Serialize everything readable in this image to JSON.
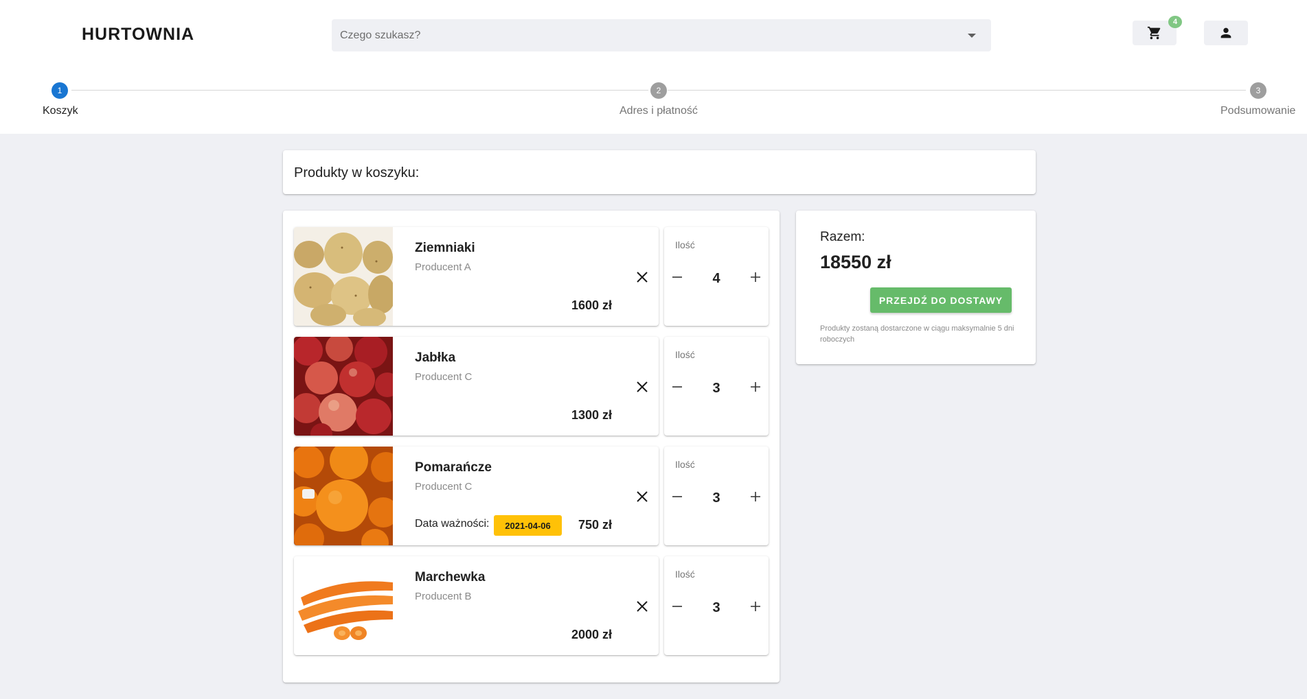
{
  "header": {
    "logo": "HURTOWNIA",
    "search_placeholder": "Czego szukasz?",
    "cart_count": "4"
  },
  "stepper": {
    "steps": [
      {
        "number": "1",
        "label": "Koszyk"
      },
      {
        "number": "2",
        "label": "Adres i płatność"
      },
      {
        "number": "3",
        "label": "Podsumowanie"
      }
    ],
    "active_step": 1
  },
  "cart": {
    "title": "Produkty w koszyku:",
    "quantity_label": "Ilość",
    "expiry_label": "Data ważności:",
    "items": [
      {
        "name": "Ziemniaki",
        "producer": "Producent A",
        "price": "1600 zł",
        "quantity": "4"
      },
      {
        "name": "Jabłka",
        "producer": "Producent C",
        "price": "1300 zł",
        "quantity": "3"
      },
      {
        "name": "Pomarańcze",
        "producer": "Producent C",
        "price": "750 zł",
        "quantity": "3",
        "expiry": "2021-04-06"
      },
      {
        "name": "Marchewka",
        "producer": "Producent B",
        "price": "2000 zł",
        "quantity": "3"
      }
    ]
  },
  "summary": {
    "total_label": "Razem:",
    "total_value": "18550 zł",
    "button_label": "PRZEJDŹ DO DOSTAWY",
    "note": "Produkty zostaną dostarczone w ciągu maksymalnie 5 dni roboczych"
  },
  "colors": {
    "accent": "#1976d2",
    "success": "#66bb6a",
    "badge": "#81c784",
    "expiry": "#ffc107"
  }
}
